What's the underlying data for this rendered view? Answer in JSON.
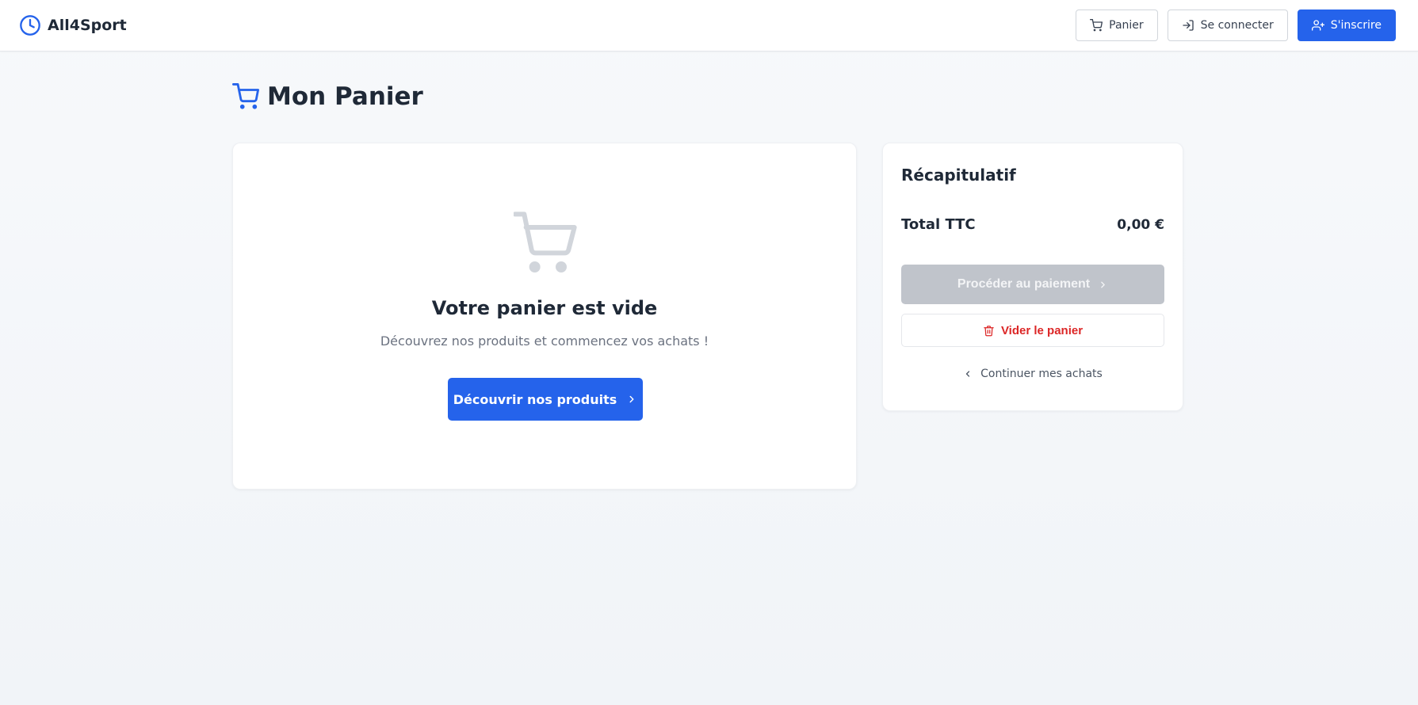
{
  "brand": {
    "name": "All4Sport"
  },
  "nav": {
    "cart_label": "Panier",
    "login_label": "Se connecter",
    "signup_label": "S'inscrire"
  },
  "page": {
    "title": "Mon Panier"
  },
  "empty_cart": {
    "title": "Votre panier est vide",
    "subtitle": "Découvrez nos produits et commencez vos achats !",
    "cta_label": "Découvrir nos produits"
  },
  "summary": {
    "title": "Récapitulatif",
    "total_label": "Total TTC",
    "total_value": "0,00 €",
    "pay_label": "Procéder au paiement",
    "clear_label": "Vider le panier",
    "continue_label": "Continuer mes achats"
  },
  "colors": {
    "primary": "#2563eb",
    "danger": "#dc2626",
    "disabled": "#c0c4cb"
  }
}
